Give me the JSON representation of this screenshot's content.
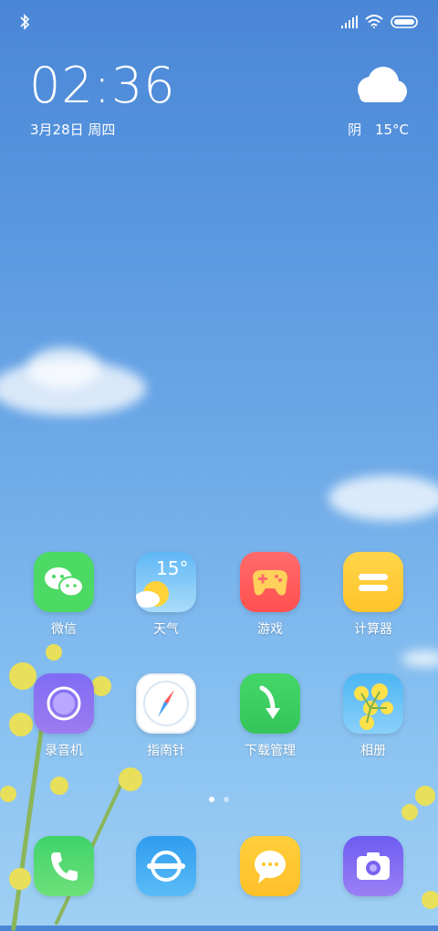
{
  "status": {
    "bluetooth_icon": "bluetooth-icon",
    "signal_icon": "signal-icon",
    "wifi_icon": "wifi-icon",
    "battery_icon": "battery-icon"
  },
  "clock": {
    "time": "02:36",
    "date": "3月28日 周四"
  },
  "weather": {
    "condition": "阴",
    "temperature": "15°C",
    "icon": "cloud-icon"
  },
  "apps": {
    "wechat": "微信",
    "weather": "天气",
    "weather_temp": "15°",
    "games": "游戏",
    "calculator": "计算器",
    "recorder": "录音机",
    "compass": "指南针",
    "downloads": "下载管理",
    "gallery": "相册"
  },
  "dock": {
    "phone_icon": "phone-icon",
    "browser_icon": "browser-icon",
    "messages_icon": "messages-icon",
    "camera_icon": "camera-icon"
  },
  "pages": {
    "count": 2,
    "active": 1
  },
  "colors": {
    "wechat": "#4cd964",
    "games": "#ff5f5f",
    "calculator": "#ffcf3a",
    "recorder": "#8b6cf0",
    "downloads": "#3fcf62",
    "phone": "#3fd36a",
    "browser": "#3aa8f2",
    "messages": "#ffc93a",
    "camera": "#7a63f0"
  }
}
